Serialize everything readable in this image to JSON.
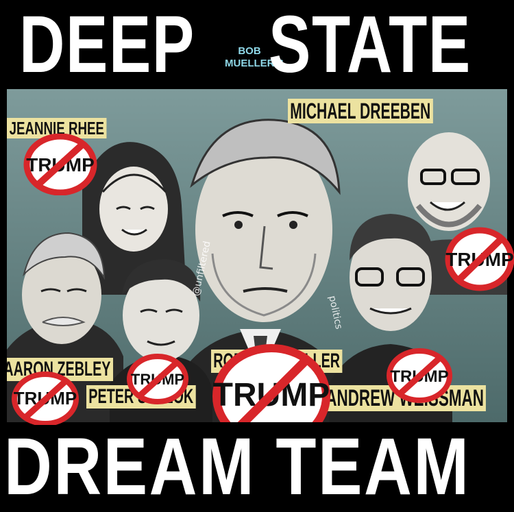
{
  "header": {
    "word_left": "DEEP",
    "word_right": "STATE",
    "small_line_1": "BOB",
    "small_line_2": "MUELLER'S"
  },
  "footer": {
    "title": "DREAM TEAM"
  },
  "people": {
    "jeannie_rhee": "JEANNIE RHEE",
    "michael_dreeben": "MICHAEL DREEBEN",
    "aaron_zebley": "AARON ZEBLEY",
    "robert_mueller": "ROBERT MUELLER",
    "peter_strzok": "PETER STRZOK",
    "andrew_weissman": "ANDREW WEISSMAN"
  },
  "badge_text": "TRUMP",
  "watermark": {
    "left": "@unfiltered",
    "right": "politics"
  },
  "colors": {
    "background": "#000000",
    "panel": "#6f8f8f",
    "label": "#ece2a0",
    "accent_small": "#8fd8e8",
    "no_sign": "#d8262a"
  }
}
